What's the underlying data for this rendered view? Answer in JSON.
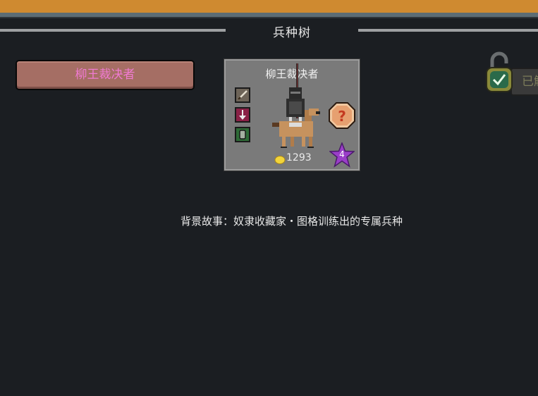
{
  "header": {
    "title": "兵种树"
  },
  "unit_list": {
    "selected_unit_label": "柳王裁决者"
  },
  "unit_card": {
    "name": "柳王裁决者",
    "cost": "1293",
    "tier": "4",
    "stat_icons": [
      "weapon-icon",
      "attack-icon",
      "defense-icon"
    ],
    "help_icon": "question-icon",
    "currency_icon": "gold-coin-icon"
  },
  "unlock": {
    "label": "已解锁",
    "icon": "unlocked-padlock-icon"
  },
  "story": {
    "text": "背景故事：奴隶收藏家・图格训练出的专属兵种"
  },
  "colors": {
    "top_bar": "#cf8a30",
    "background": "#1b1e22",
    "button_fill": "#a56e64",
    "button_text": "#f07ad2",
    "card_fill": "#7a7a7a",
    "star": "#9a3ec8"
  }
}
